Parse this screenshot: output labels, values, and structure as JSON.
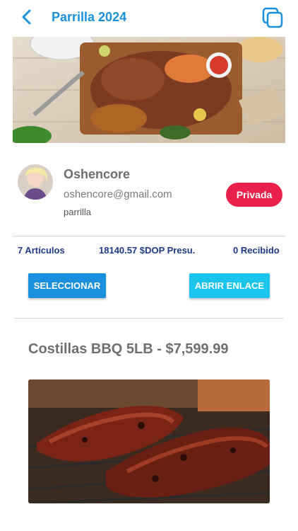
{
  "header": {
    "title": "Parrilla 2024",
    "back_icon": "chevron-left-icon",
    "copy_icon": "copy-icon",
    "accent": "#1a8fdd"
  },
  "hero": {
    "alt": "grill platter"
  },
  "profile": {
    "name": "Oshencore",
    "email": "oshencore@gmail.com",
    "tag": "parrilla",
    "badge": "Privada",
    "badge_color": "#e8204a"
  },
  "stats": {
    "items": "7 Artículos",
    "budget": "18140.57 $DOP Presu.",
    "received": "0 Recibido"
  },
  "actions": {
    "select_label": "SELECCIONAR",
    "open_link_label": "ABRIR ENLACE"
  },
  "product": {
    "title": "Costillas BBQ 5LB - $7,599.99"
  }
}
